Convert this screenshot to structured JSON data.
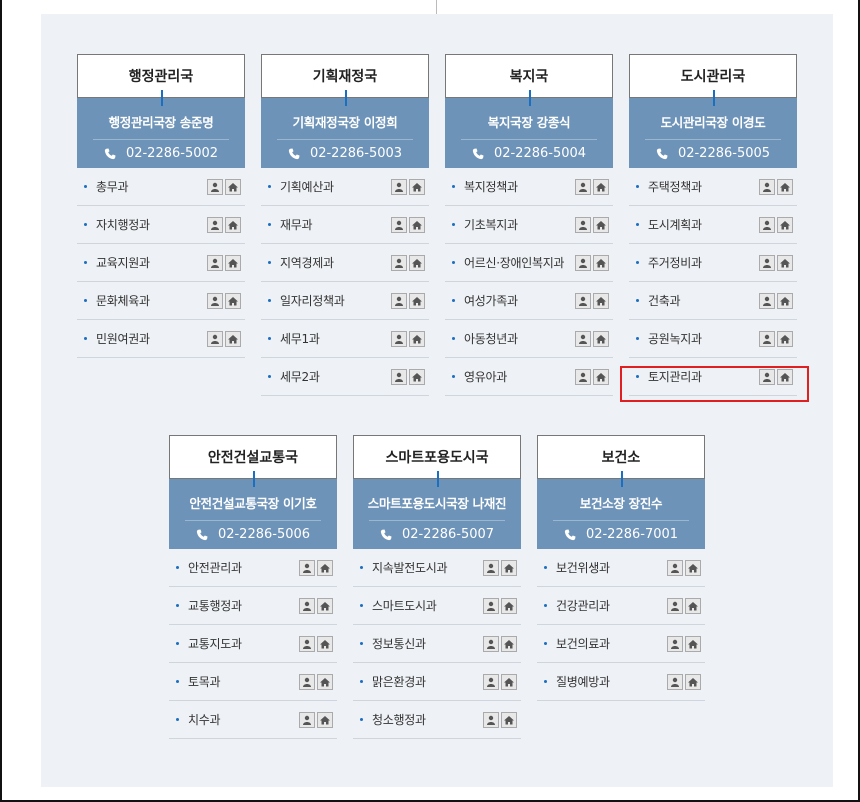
{
  "departments": [
    {
      "title": "행정관리국",
      "head": "행정관리국장 송준명",
      "phone": "02-2286-5002",
      "offices": [
        "총무과",
        "자치행정과",
        "교육지원과",
        "문화체육과",
        "민원여권과"
      ]
    },
    {
      "title": "기획재정국",
      "head": "기획재정국장 이정희",
      "phone": "02-2286-5003",
      "offices": [
        "기획예산과",
        "재무과",
        "지역경제과",
        "일자리정책과",
        "세무1과",
        "세무2과"
      ]
    },
    {
      "title": "복지국",
      "head": "복지국장 강종식",
      "phone": "02-2286-5004",
      "offices": [
        "복지정책과",
        "기초복지과",
        "어르신·장애인복지과",
        "여성가족과",
        "아동청년과",
        "영유아과"
      ]
    },
    {
      "title": "도시관리국",
      "head": "도시관리국장 이경도",
      "phone": "02-2286-5005",
      "offices": [
        "주택정책과",
        "도시계획과",
        "주거정비과",
        "건축과",
        "공원녹지과",
        "토지관리과"
      ]
    },
    {
      "title": "안전건설교통국",
      "head": "안전건설교통국장 이기호",
      "phone": "02-2286-5006",
      "offices": [
        "안전관리과",
        "교통행정과",
        "교통지도과",
        "토목과",
        "치수과"
      ]
    },
    {
      "title": "스마트포용도시국",
      "head": "스마트포용도시국장 나재진",
      "phone": "02-2286-5007",
      "offices": [
        "지속발전도시과",
        "스마트도시과",
        "정보통신과",
        "맑은환경과",
        "청소행정과"
      ]
    },
    {
      "title": "보건소",
      "head": "보건소장 장진수",
      "phone": "02-2286-7001",
      "offices": [
        "보건위생과",
        "건강관리과",
        "보건의료과",
        "질병예방과"
      ]
    }
  ],
  "icons": {
    "person": "person-icon",
    "home": "home-icon",
    "phone": "phone-icon"
  },
  "colors": {
    "head_bg": "#6e93b8",
    "accent": "#1b6fc1",
    "highlight": "#e02020"
  }
}
